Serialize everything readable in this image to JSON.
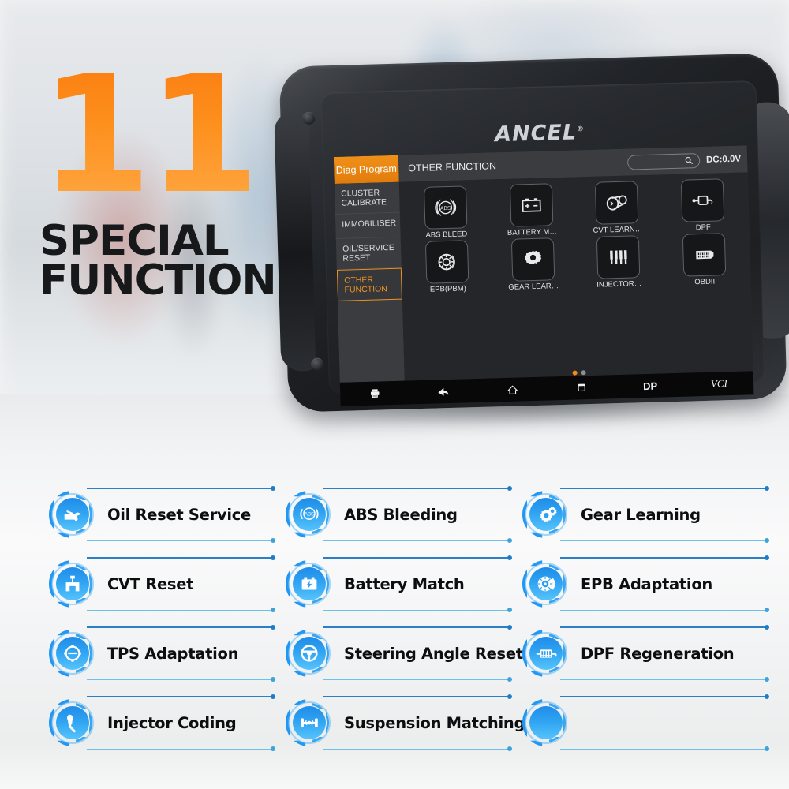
{
  "headline": {
    "number": "11",
    "title_line1": "SPECIAL",
    "title_line2": "FUNCTIONS",
    "accent_color": "#fb8114"
  },
  "tablet": {
    "brand": "ANCEL",
    "brand_mark": "®",
    "screen": {
      "diag_tab": "Diag Program",
      "page_title": "OTHER FUNCTION",
      "search_placeholder": "",
      "search_icon": "search-icon",
      "voltage": "DC:0.0V",
      "sidebar": [
        {
          "label": "CLUSTER CALIBRATE",
          "active": false
        },
        {
          "label": "IMMOBILISER",
          "active": false
        },
        {
          "label": "OIL/SERVICE RESET",
          "active": false
        },
        {
          "label": "OTHER FUNCTION",
          "active": true
        }
      ],
      "tiles": [
        {
          "label": "ABS BLEED",
          "icon": "abs-icon"
        },
        {
          "label": "BATTERY M…",
          "icon": "battery-icon"
        },
        {
          "label": "CVT LEARN…",
          "icon": "cvt-icon"
        },
        {
          "label": "DPF",
          "icon": "dpf-icon"
        },
        {
          "label": "EPB(PBM)",
          "icon": "brake-disc-icon"
        },
        {
          "label": "GEAR LEAR…",
          "icon": "gear-icon"
        },
        {
          "label": "INJECTOR…",
          "icon": "injector-icon"
        },
        {
          "label": "OBDII",
          "icon": "obd-connector-icon"
        }
      ],
      "pagination": {
        "total": 2,
        "active_index": 0
      },
      "navbar": [
        {
          "label": "",
          "icon": "printer-icon",
          "type": "icon"
        },
        {
          "label": "",
          "icon": "back-arrow-icon",
          "type": "icon"
        },
        {
          "label": "",
          "icon": "home-icon",
          "type": "icon"
        },
        {
          "label": "",
          "icon": "recents-icon",
          "type": "icon"
        },
        {
          "label": "DP",
          "icon": "",
          "type": "text"
        },
        {
          "label": "VCI",
          "icon": "",
          "type": "text-italic"
        }
      ]
    }
  },
  "features": {
    "accent_color": "#2196f3",
    "items": [
      {
        "label": "Oil Reset Service",
        "icon": "oil-can-icon"
      },
      {
        "label": "ABS Bleeding",
        "icon": "abs-icon"
      },
      {
        "label": "Gear Learning",
        "icon": "gears-icon"
      },
      {
        "label": "CVT Reset",
        "icon": "cvt-icon"
      },
      {
        "label": "Battery Match",
        "icon": "battery-icon"
      },
      {
        "label": "EPB Adaptation",
        "icon": "brake-disc-icon"
      },
      {
        "label": "TPS Adaptation",
        "icon": "throttle-icon"
      },
      {
        "label": "Steering Angle Reset",
        "icon": "steering-wheel-icon"
      },
      {
        "label": "DPF Regeneration",
        "icon": "dpf-filter-icon"
      },
      {
        "label": "Injector Coding",
        "icon": "injector-icon"
      },
      {
        "label": "Suspension Matching",
        "icon": "suspension-icon"
      },
      {
        "label": "",
        "icon": ""
      }
    ]
  }
}
